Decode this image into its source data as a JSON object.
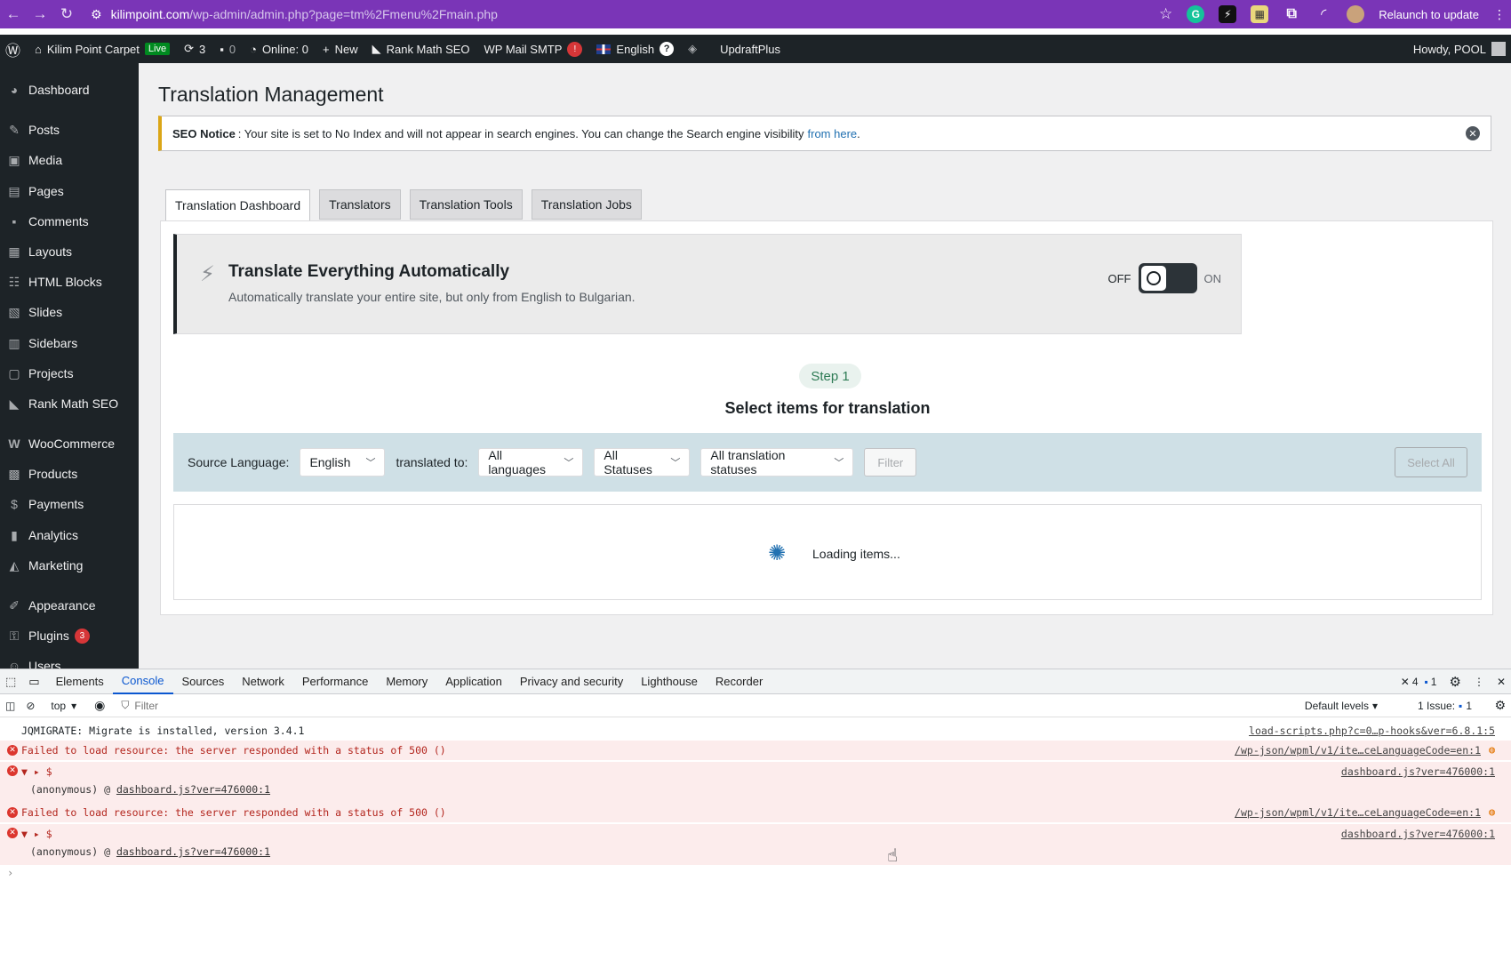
{
  "browser": {
    "url_host": "kilimpoint.com",
    "url_path": "/wp-admin/admin.php?page=tm%2Fmenu%2Fmain.php",
    "relaunch": "Relaunch to update"
  },
  "adminbar": {
    "site": "Kilim Point Carpet",
    "live": "Live",
    "updates": "3",
    "comments": "0",
    "online": "Online: 0",
    "new": "New",
    "rankmath": "Rank Math SEO",
    "smtp": "WP Mail SMTP",
    "smtp_badge": "!",
    "lang": "English",
    "lang_badge": "?",
    "updraft": "UpdraftPlus",
    "howdy": "Howdy, POOL"
  },
  "sidebar": {
    "items": [
      {
        "label": "Dashboard"
      },
      {
        "label": "Posts"
      },
      {
        "label": "Media"
      },
      {
        "label": "Pages"
      },
      {
        "label": "Comments"
      },
      {
        "label": "Layouts"
      },
      {
        "label": "HTML Blocks"
      },
      {
        "label": "Slides"
      },
      {
        "label": "Sidebars"
      },
      {
        "label": "Projects"
      },
      {
        "label": "Rank Math SEO"
      },
      {
        "label": "WooCommerce"
      },
      {
        "label": "Products"
      },
      {
        "label": "Payments"
      },
      {
        "label": "Analytics"
      },
      {
        "label": "Marketing"
      },
      {
        "label": "Appearance"
      },
      {
        "label": "Plugins",
        "badge": "3"
      },
      {
        "label": "Users"
      }
    ]
  },
  "main": {
    "title": "Translation Management",
    "notice": {
      "bold": "SEO Notice",
      "text": ": Your site is set to No Index and will not appear in search engines. You can change the Search engine visibility",
      "link": "from here",
      "end": "."
    },
    "tabs": [
      "Translation Dashboard",
      "Translators",
      "Translation Tools",
      "Translation Jobs"
    ],
    "auto": {
      "title": "Translate Everything Automatically",
      "subtitle": "Automatically translate your entire site, but only from English to Bulgarian.",
      "off": "OFF",
      "on": "ON"
    },
    "step": "Step 1",
    "step_title": "Select items for translation",
    "filters": {
      "source_label": "Source Language:",
      "source_value": "English",
      "translated_label": "translated to:",
      "languages": "All languages",
      "statuses": "All Statuses",
      "translation_statuses": "All translation statuses",
      "filter_btn": "Filter",
      "select_all": "Select All"
    },
    "loading": "Loading items..."
  },
  "devtools": {
    "tabs": [
      "Elements",
      "Console",
      "Sources",
      "Network",
      "Performance",
      "Memory",
      "Application",
      "Privacy and security",
      "Lighthouse",
      "Recorder"
    ],
    "errors": "4",
    "messages": "1",
    "context": "top",
    "filter_placeholder": "Filter",
    "levels": "Default levels",
    "issues": "1 Issue:",
    "issues_count": "1",
    "logs": [
      {
        "text": "JQMIGRATE: Migrate is installed, version 3.4.1",
        "src": "load-scripts.php?c=0…p-hooks&ver=6.8.1:5"
      },
      {
        "text": "Failed to load resource: the server responded with a status of 500 ()",
        "src": "/wp-json/wpml/v1/ite…ceLanguageCode=en:1"
      },
      {
        "text": "▼ ▸ $",
        "src": "dashboard.js?ver=476000:1",
        "sub_pre": "(anonymous) @ ",
        "sub_link": "dashboard.js?ver=476000:1"
      },
      {
        "text": "Failed to load resource: the server responded with a status of 500 ()",
        "src": "/wp-json/wpml/v1/ite…ceLanguageCode=en:1"
      },
      {
        "text": "▼ ▸ $",
        "src": "dashboard.js?ver=476000:1",
        "sub_pre": "(anonymous) @ ",
        "sub_link": "dashboard.js?ver=476000:1"
      }
    ],
    "prompt": "›"
  }
}
